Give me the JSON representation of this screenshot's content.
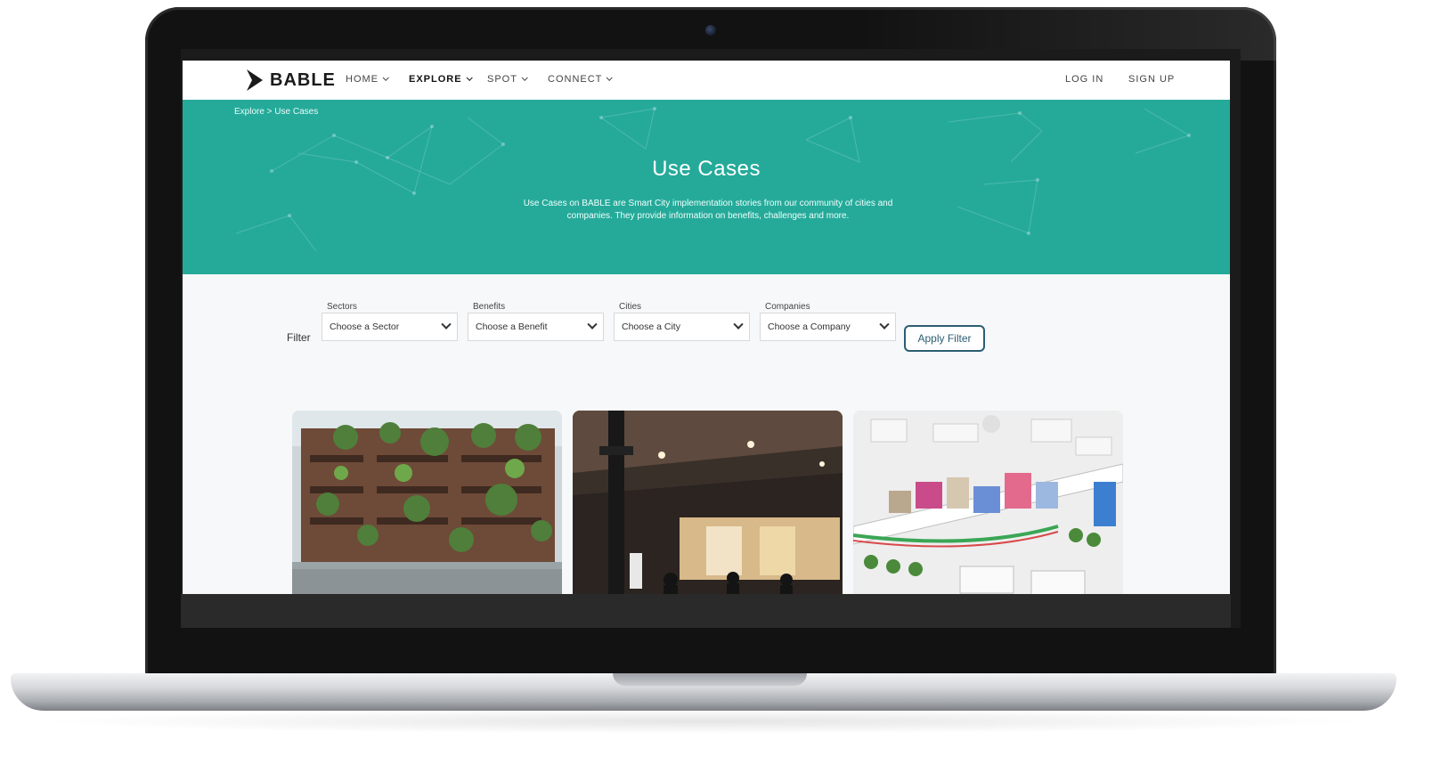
{
  "brand": {
    "name": "BABLE",
    "accent": "#25aa9a"
  },
  "nav": {
    "items": [
      {
        "label": "HOME"
      },
      {
        "label": "EXPLORE"
      },
      {
        "label": "SPOT"
      },
      {
        "label": "CONNECT"
      }
    ],
    "login": "LOG IN",
    "signup": "SIGN UP"
  },
  "hero": {
    "breadcrumb": "Explore > Use Cases",
    "title": "Use Cases",
    "description": "Use Cases on BABLE are Smart City implementation stories from our community of cities and companies. They provide information on benefits, challenges and more."
  },
  "filter": {
    "label": "Filter",
    "groups": [
      {
        "label": "Sectors",
        "value": "Choose a Sector"
      },
      {
        "label": "Benefits",
        "value": "Choose a Benefit"
      },
      {
        "label": "Cities",
        "value": "Choose a City"
      },
      {
        "label": "Companies",
        "value": "Choose a Company"
      }
    ],
    "apply": "Apply Filter"
  },
  "cards": [
    {
      "image": "green-building-photo"
    },
    {
      "image": "train-station-photo"
    },
    {
      "image": "isometric-city-illustration"
    }
  ]
}
